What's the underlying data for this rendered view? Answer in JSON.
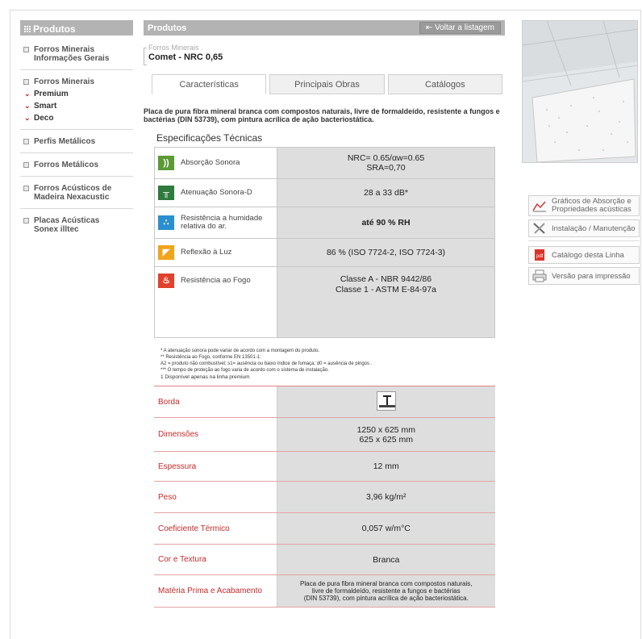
{
  "sidebar": {
    "header": "Produtos",
    "items": [
      {
        "label": "Forros Minerais Informações Gerais"
      },
      {
        "label": "Forros Minerais",
        "subs": [
          "Premium",
          "Smart",
          "Deco"
        ]
      },
      {
        "label": "Perfis Metálicos"
      },
      {
        "label": "Forros Metálicos"
      },
      {
        "label": "Forros Acústicos de Madeira Nexacustic"
      },
      {
        "label": "Placas Acústicas Sonex illtec"
      }
    ]
  },
  "main": {
    "header": "Produtos",
    "back_label": "Voltar a listagem",
    "crumb_category": "Forros Minerais",
    "product_title": "Comet - NRC 0,65",
    "tabs": [
      {
        "label": "Características",
        "active": true
      },
      {
        "label": "Principais Obras",
        "active": false
      },
      {
        "label": "Catálogos",
        "active": false
      }
    ],
    "description": "Placa de pura fibra mineral branca com compostos naturais, livre de formaldeído, resistente a fungos e bactérias (DIN 53739), com pintura acrílica de ação bacteriostática.",
    "spec_title": "Especificações Técnicas",
    "specs": [
      {
        "icon": "sound-absorption-icon",
        "color": "#5b9a37",
        "label": "Absorção Sonora",
        "value1": "NRC= 0.65/αw=0.65",
        "value2": "SRA=0,70"
      },
      {
        "icon": "sound-attenuation-icon",
        "color": "#2f7a3e",
        "label": "Atenuação Sonora-D",
        "value1": "28 a 33 dB*",
        "value2": ""
      },
      {
        "icon": "humidity-icon",
        "color": "#2a8fd1",
        "label": "Resistência a humidade relativa do ar.",
        "value1": "até 90 % RH",
        "value2": ""
      },
      {
        "icon": "light-reflection-icon",
        "color": "#f0a51c",
        "label": "Reflexão à Luz",
        "value1": "86 % (ISO 7724-2, ISO 7724-3)",
        "value2": ""
      },
      {
        "icon": "fire-resistance-icon",
        "color": "#e0422c",
        "label": "Resistência ao Fogo",
        "value1": "Classe A  - NBR 9442/86",
        "value2": "Classe 1  - ASTM E-84-97a"
      }
    ],
    "notes": [
      "*   A atenuação sonora pode variar de acordo com a montagem do produto.",
      "**   Resistência ao Fogo, conforme EN 13501-1:",
      "        A2 = produto não combustível;   s1= ausência ou baixo índice de fumaça;   d0 = ausência de pingos .",
      "***  O tempo de proteção ao fogo varia de acordo com o sistema de instalação.",
      "1  Disponível apenas na linha premium"
    ],
    "properties": [
      {
        "label": "Borda",
        "value1": "",
        "value2": "",
        "edge_icon": true
      },
      {
        "label": "Dimensões",
        "value1": "1250 x 625 mm",
        "value2": "625 x 625 mm"
      },
      {
        "label": "Espessura",
        "value1": "12 mm",
        "value2": ""
      },
      {
        "label": "Peso",
        "value1": "3,96 kg/m²",
        "value2": ""
      },
      {
        "label": "Coeficiente Térmico",
        "value1": "0,057 w/m°C",
        "value2": ""
      },
      {
        "label": "Cor e Textura",
        "value1": "Branca",
        "value2": ""
      },
      {
        "label": "Matéria Prima e Acabamento",
        "value1": "Placa de pura fibra mineral branca com compostos naturais,",
        "value2": "livre de formaldeído, resistente a fungos e bactérias",
        "value3": "(DIN 53739), com pintura acrílica de ação bacteriostática."
      }
    ]
  },
  "right": {
    "links": [
      {
        "label": "Gráficos de Absorção e Propriedades acústicas",
        "icon": "graph-icon"
      },
      {
        "label": "Instalação / Manutenção",
        "icon": "tools-icon"
      },
      {
        "label": "Catálogo desta Linha",
        "icon": "pdf-icon"
      },
      {
        "label": "Versão para impressão",
        "icon": "print-icon"
      }
    ]
  }
}
